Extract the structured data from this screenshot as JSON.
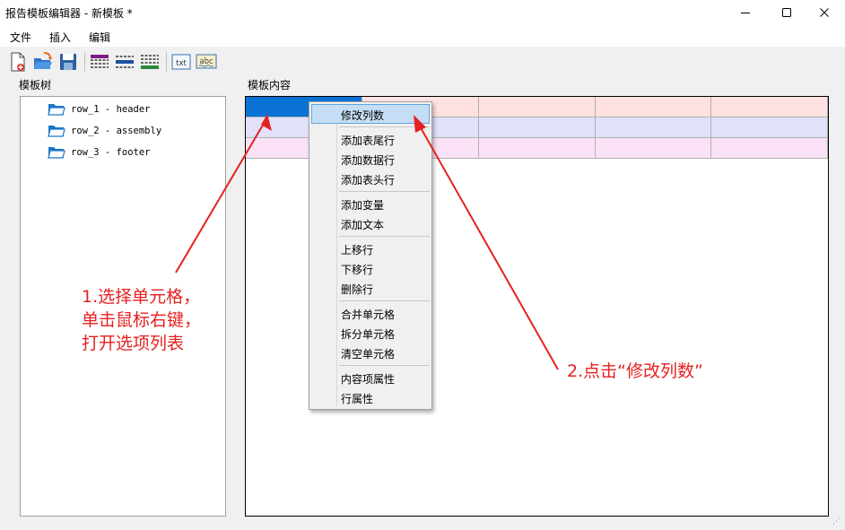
{
  "window": {
    "title": "报告模板编辑器 - 新模板 *",
    "controls": {
      "minimize": "—",
      "maximize": "☐",
      "close": "✕"
    }
  },
  "menu": {
    "file": "文件",
    "insert": "插入",
    "edit": "编辑"
  },
  "toolbar": {
    "buttons": [
      "new-file-icon",
      "open-file-icon",
      "save-icon",
      "insert-header-row-icon",
      "insert-data-row-icon",
      "insert-footer-row-icon",
      "insert-variable-icon",
      "insert-text-icon"
    ],
    "txt_label": "txt",
    "abc_label": "abc"
  },
  "tree": {
    "label": "模板树",
    "items": [
      {
        "label": "row_1 - header"
      },
      {
        "label": "row_2 - assembly"
      },
      {
        "label": "row_3 - footer"
      }
    ]
  },
  "content": {
    "label": "模板内容",
    "rows": [
      "header",
      "assembly",
      "footer"
    ],
    "columns": 5,
    "selected_cell": {
      "row": 1,
      "col": 1
    },
    "row_colors": {
      "header": "#ffe1e1",
      "assembly": "#e1e1fa",
      "footer": "#fae1f5"
    },
    "selection_color": "#0a72d4"
  },
  "context_menu": {
    "highlighted": "modify_columns",
    "items": {
      "modify_columns": "修改列数",
      "add_footer_row": "添加表尾行",
      "add_data_row": "添加数据行",
      "add_header_row": "添加表头行",
      "add_variable": "添加变量",
      "add_text": "添加文本",
      "move_up": "上移行",
      "move_down": "下移行",
      "delete_row": "删除行",
      "merge_cells": "合并单元格",
      "split_cell": "拆分单元格",
      "clear_cell": "清空单元格",
      "item_properties": "内容项属性",
      "row_properties": "行属性"
    }
  },
  "annotations": {
    "note1": [
      "1.选择单元格，",
      "单击鼠标右键，",
      "打开选项列表"
    ],
    "note2": "2.点击“修改列数”",
    "color": "#e62020"
  }
}
